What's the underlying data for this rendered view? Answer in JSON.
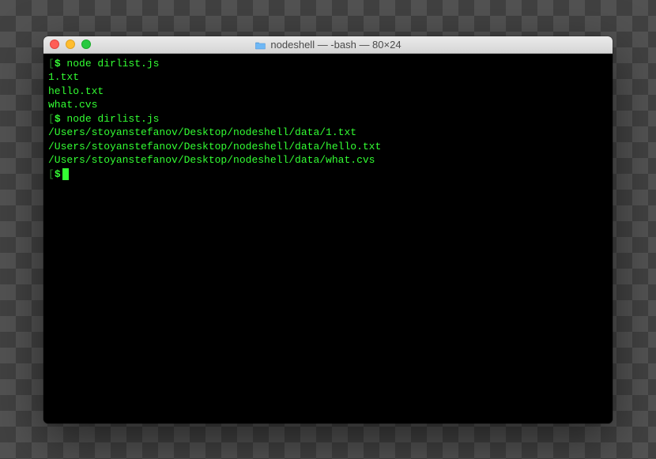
{
  "window": {
    "title": "nodeshell — -bash — 80×24"
  },
  "session": {
    "lines": [
      {
        "type": "prompt",
        "cmd": "node dirlist.js"
      },
      {
        "type": "output",
        "text": "1.txt"
      },
      {
        "type": "output",
        "text": "hello.txt"
      },
      {
        "type": "output",
        "text": "what.cvs"
      },
      {
        "type": "prompt",
        "cmd": "node dirlist.js"
      },
      {
        "type": "output",
        "text": "/Users/stoyanstefanov/Desktop/nodeshell/data/1.txt"
      },
      {
        "type": "output",
        "text": "/Users/stoyanstefanov/Desktop/nodeshell/data/hello.txt"
      },
      {
        "type": "output",
        "text": "/Users/stoyanstefanov/Desktop/nodeshell/data/what.cvs"
      },
      {
        "type": "prompt-empty"
      }
    ],
    "prompt": {
      "open_bracket": "[",
      "dollar": "$",
      "close_bracket": "]"
    }
  }
}
